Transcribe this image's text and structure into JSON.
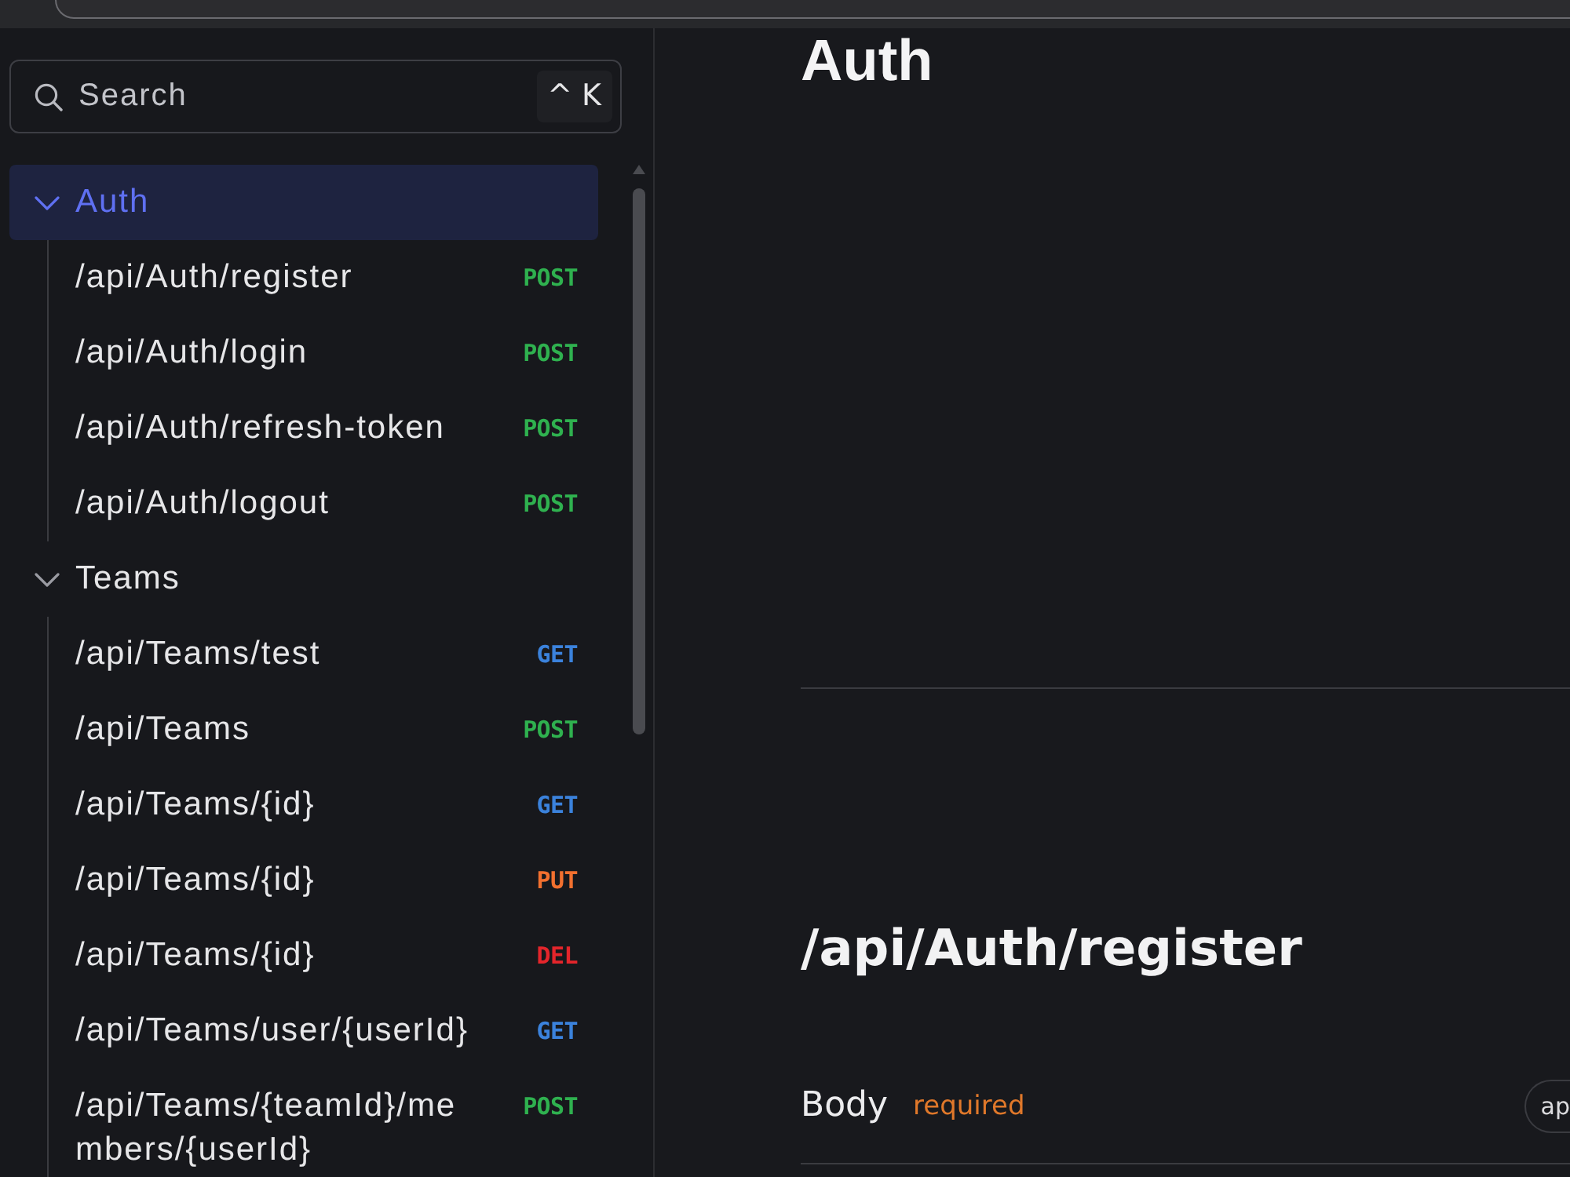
{
  "sidebar": {
    "search": {
      "placeholder": "Search",
      "shortcut": "^ K"
    },
    "groups": [
      {
        "label": "Auth",
        "selected": true,
        "expanded": true,
        "children": [
          {
            "path": "/api/Auth/register",
            "method": "POST",
            "color": "#2fb14f",
            "selected": false
          },
          {
            "path": "/api/Auth/login",
            "method": "POST",
            "color": "#2fb14f",
            "selected": false
          },
          {
            "path": "/api/Auth/refresh-token",
            "method": "POST",
            "color": "#2fb14f",
            "selected": false
          },
          {
            "path": "/api/Auth/logout",
            "method": "POST",
            "color": "#2fb14f",
            "selected": false
          }
        ]
      },
      {
        "label": "Teams",
        "selected": false,
        "expanded": true,
        "children": [
          {
            "path": "/api/Teams/test",
            "method": "GET",
            "color": "#3b82dc",
            "selected": false
          },
          {
            "path": "/api/Teams",
            "method": "POST",
            "color": "#2fb14f",
            "selected": false
          },
          {
            "path": "/api/Teams/{id}",
            "method": "GET",
            "color": "#3b82dc",
            "selected": false
          },
          {
            "path": "/api/Teams/{id}",
            "method": "PUT",
            "color": "#f2702f",
            "selected": false
          },
          {
            "path": "/api/Teams/{id}",
            "method": "DEL",
            "color": "#e4252b",
            "selected": false
          },
          {
            "path": "/api/Teams/user/{userId}",
            "method": "GET",
            "color": "#3b82dc",
            "selected": false
          },
          {
            "path": "/api/Teams/{teamId}/members/{userId}",
            "method": "POST",
            "color": "#2fb14f",
            "selected": false
          }
        ]
      }
    ]
  },
  "main": {
    "tag": {
      "title": "Auth"
    },
    "operation": {
      "title": "/api/Auth/register",
      "body": {
        "label": "Body",
        "required": "required",
        "content_type": "ap"
      }
    }
  }
}
